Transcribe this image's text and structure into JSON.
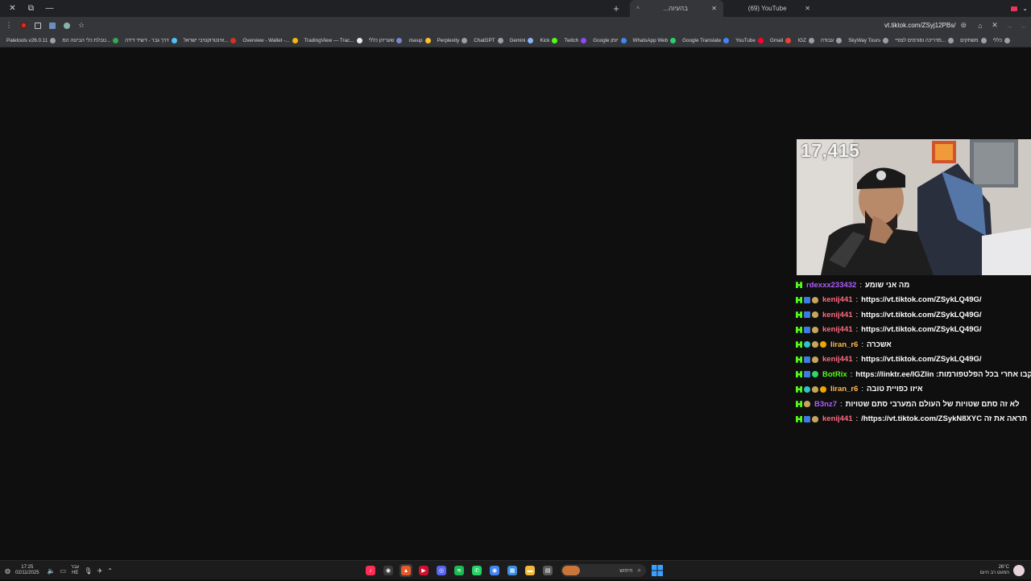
{
  "browser": {
    "tabs": [
      {
        "title": "בהעיוה...",
        "favicon": "generic-icon",
        "active": true
      },
      {
        "title": "(69) YouTube",
        "favicon": "youtube-icon",
        "active": false
      }
    ],
    "new_tab_glyph": "+",
    "url": "vt.tiktok.com/ZSyj12PBs/",
    "bookmarks": [
      {
        "label": "Paletools v26.0.11",
        "color": "#9aa0a6"
      },
      {
        "label": "טבלת כלי הביטה המ...",
        "color": "#34a853"
      },
      {
        "label": "דרך גבר - דשיד דידה",
        "color": "#4fc3f7"
      },
      {
        "label": "אינטרוקטיבי ישראל...",
        "color": "#d93025"
      },
      {
        "label": "Overview - Wallet -...",
        "color": "#f0b90b"
      },
      {
        "label": "TradingView — Trac...",
        "color": "#e8eaed"
      },
      {
        "label": "שעריהן כללי",
        "color": "#7986cb"
      },
      {
        "label": "riseup",
        "color": "#fbc02d"
      },
      {
        "label": "Perplexity",
        "color": "#9aa0a6"
      },
      {
        "label": "ChatGPT",
        "color": "#9aa0a6"
      },
      {
        "label": "Gemini",
        "color": "#8ab4f8"
      },
      {
        "label": "Kick",
        "color": "#53fc18"
      },
      {
        "label": "Twitch",
        "color": "#9146ff"
      },
      {
        "label": "Google יומן",
        "color": "#4285f4"
      },
      {
        "label": "WhatsApp Web",
        "color": "#25d366"
      },
      {
        "label": "Google Translate",
        "color": "#4285f4"
      },
      {
        "label": "YouTube",
        "color": "#ff0033"
      },
      {
        "label": "Gmail",
        "color": "#ea4335"
      },
      {
        "label": "IGZ",
        "color": "#9aa0a6"
      },
      {
        "label": "עבודה",
        "color": "#9aa0a6"
      },
      {
        "label": "SkyWay Tours",
        "color": "#9aa0a6"
      },
      {
        "label": "מדריכה ופורמים לצפיי...",
        "color": "#9aa0a6"
      },
      {
        "label": "משחקים",
        "color": "#9aa0a6"
      },
      {
        "label": "כללי",
        "color": "#9aa0a6"
      }
    ]
  },
  "stream": {
    "viewer_count": "17,415",
    "chat": [
      {
        "user": "rdexxx233432",
        "user_color": "#b05cff",
        "badges": [
          "kick"
        ],
        "message": "מה אני שומע"
      },
      {
        "user": "kenij441",
        "user_color": "#ff6b81",
        "badges": [
          "kick",
          "blue",
          "sub"
        ],
        "message": "https://vt.tiktok.com/ZSykLQ49G/"
      },
      {
        "user": "kenij441",
        "user_color": "#ff6b81",
        "badges": [
          "kick",
          "blue",
          "sub"
        ],
        "message": "https://vt.tiktok.com/ZSykLQ49G/"
      },
      {
        "user": "kenij441",
        "user_color": "#ff6b81",
        "badges": [
          "kick",
          "blue",
          "sub"
        ],
        "message": "https://vt.tiktok.com/ZSykLQ49G/"
      },
      {
        "user": "liran_r6",
        "user_color": "#ffb84d",
        "badges": [
          "kick",
          "gem",
          "sub",
          "gold"
        ],
        "message": "אשכרה"
      },
      {
        "user": "kenij441",
        "user_color": "#ff6b81",
        "badges": [
          "kick",
          "blue",
          "sub"
        ],
        "message": "https://vt.tiktok.com/ZSykLQ49G/"
      },
      {
        "user": "BotRix",
        "user_color": "#53fc18",
        "badges": [
          "kick",
          "blue",
          "green"
        ],
        "message": "עקבו אחרי בכל הפלטפורמות: https://linktr.ee/IGZlin"
      },
      {
        "user": "liran_r6",
        "user_color": "#ffb84d",
        "badges": [
          "kick",
          "gem",
          "sub",
          "gold"
        ],
        "message": "איזו כפויית טובה"
      },
      {
        "user": "B3nz7",
        "user_color": "#b05cff",
        "badges": [
          "kick",
          "sub"
        ],
        "message": "לא זה סתם שטויות של העולם המערבי סתם שטויות"
      },
      {
        "user": "kenij441",
        "user_color": "#ff6b81",
        "badges": [
          "kick",
          "blue",
          "sub"
        ],
        "message": "תראה את זה https://vt.tiktok.com/ZSykN8XYC/"
      }
    ]
  },
  "taskbar": {
    "time": "17:25",
    "date": "02/11/2025",
    "lang_top": "עבר",
    "lang_bottom": "HE",
    "search_placeholder": "חיפוש",
    "weather_temp": "26°C",
    "weather_text": "המעט רב היום",
    "apps": [
      {
        "name": "tiktok-icon",
        "color": "#ff2d55",
        "glyph": "♪"
      },
      {
        "name": "steam-icon",
        "color": "#3a3a3a",
        "glyph": "◉"
      },
      {
        "name": "fire-icon",
        "color": "#e65a2a",
        "glyph": "▲",
        "active": true
      },
      {
        "name": "youtube-icon",
        "color": "#d10f2f",
        "glyph": "▶"
      },
      {
        "name": "discord-icon",
        "color": "#5865f2",
        "glyph": "◎"
      },
      {
        "name": "spotify-icon",
        "color": "#1db954",
        "glyph": "≋"
      },
      {
        "name": "whatsapp-icon",
        "color": "#25d366",
        "glyph": "✆"
      },
      {
        "name": "chrome-icon",
        "color": "#4285f4",
        "glyph": "◉"
      },
      {
        "name": "photos-icon",
        "color": "#3a8ee6",
        "glyph": "▦"
      },
      {
        "name": "folder-icon",
        "color": "#f3b83a",
        "glyph": "▬"
      },
      {
        "name": "notepad-icon",
        "color": "#5a5a5a",
        "glyph": "▤"
      }
    ]
  }
}
